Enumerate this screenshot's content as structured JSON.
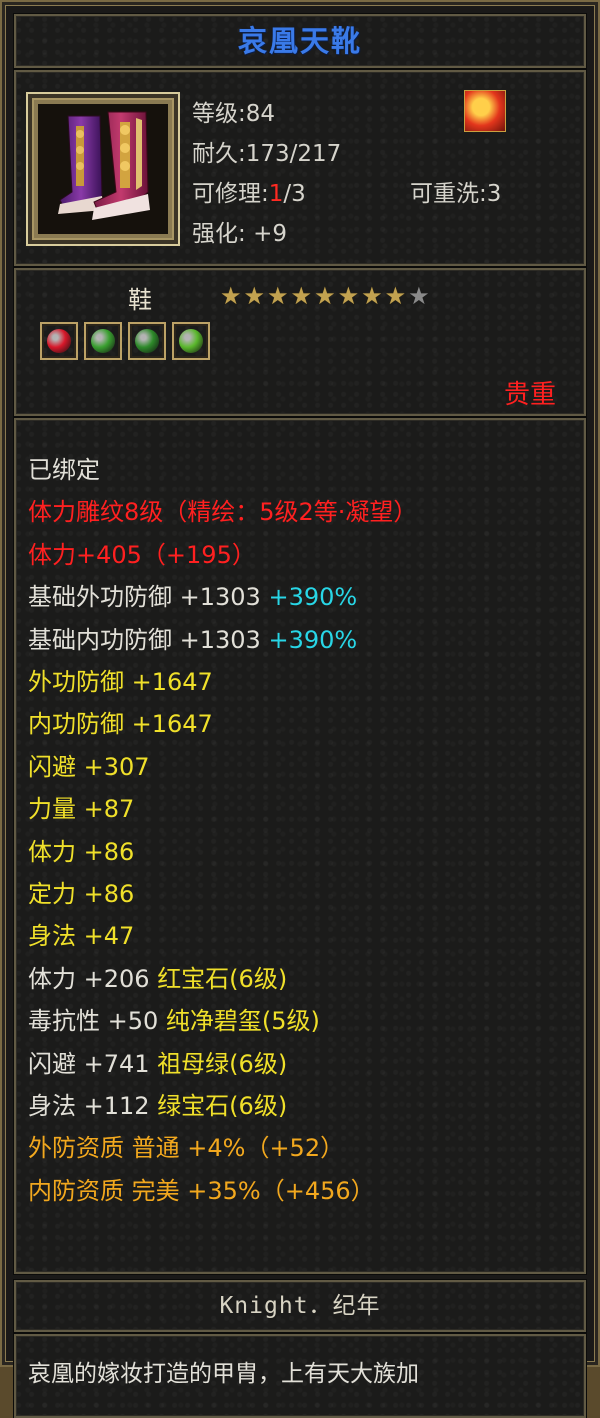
{
  "item": {
    "name": "哀凰天靴",
    "level_label": "等级",
    "level": "84",
    "durability_label": "耐久",
    "durability": "173/217",
    "repair_label": "可修理",
    "repair_used": "1",
    "repair_total": "/3",
    "rewash_label": "可重洗",
    "rewash": "3",
    "enhance_label": "强化",
    "enhance": "+9",
    "type": "鞋",
    "stars_on": 8,
    "stars_total": 9,
    "rarity": "贵重",
    "gems": [
      {
        "icon": "red-gem-icon",
        "color": "#d8182a"
      },
      {
        "icon": "green-gem-icon",
        "color": "#3aa030"
      },
      {
        "icon": "green-leaf-gem-icon",
        "color": "#2e8a2a"
      },
      {
        "icon": "jade-gem-icon",
        "color": "#5ab82c"
      }
    ]
  },
  "stats": [
    {
      "text": "已绑定",
      "color": "white"
    },
    {
      "text": "体力雕纹8级（精绘：5级2等·凝望）",
      "color": "red"
    },
    {
      "text": "体力+405（+195）",
      "color": "red"
    },
    {
      "parts": [
        {
          "text": "基础外功防御 +1303 ",
          "color": "white"
        },
        {
          "text": "+390%",
          "color": "cyan"
        }
      ]
    },
    {
      "parts": [
        {
          "text": "基础内功防御 +1303 ",
          "color": "white"
        },
        {
          "text": "+390%",
          "color": "cyan"
        }
      ]
    },
    {
      "text": "外功防御 +1647",
      "color": "yellow"
    },
    {
      "text": "内功防御 +1647",
      "color": "yellow"
    },
    {
      "text": "闪避 +307",
      "color": "yellow"
    },
    {
      "text": "力量 +87",
      "color": "yellow"
    },
    {
      "text": "体力 +86",
      "color": "yellow"
    },
    {
      "text": "定力 +86",
      "color": "yellow"
    },
    {
      "text": "身法 +47",
      "color": "yellow"
    },
    {
      "parts": [
        {
          "text": "体力 +206 ",
          "color": "white"
        },
        {
          "text": "红宝石(6级)",
          "color": "yellow"
        }
      ]
    },
    {
      "parts": [
        {
          "text": "毒抗性 +50 ",
          "color": "white"
        },
        {
          "text": "纯净碧玺(5级)",
          "color": "yellow"
        }
      ]
    },
    {
      "parts": [
        {
          "text": "闪避 +741 ",
          "color": "white"
        },
        {
          "text": "祖母绿(6级)",
          "color": "yellow"
        }
      ]
    },
    {
      "parts": [
        {
          "text": "身法 +112 ",
          "color": "white"
        },
        {
          "text": "绿宝石(6级)",
          "color": "yellow"
        }
      ]
    },
    {
      "text": "外防资质  普通 +4%（+52）",
      "color": "orange"
    },
    {
      "text": "内防资质  完美 +35%（+456）",
      "color": "orange"
    }
  ],
  "maker": "Knight．纪年",
  "description": "哀凰的嫁妆打造的甲胄，上有天大族加"
}
